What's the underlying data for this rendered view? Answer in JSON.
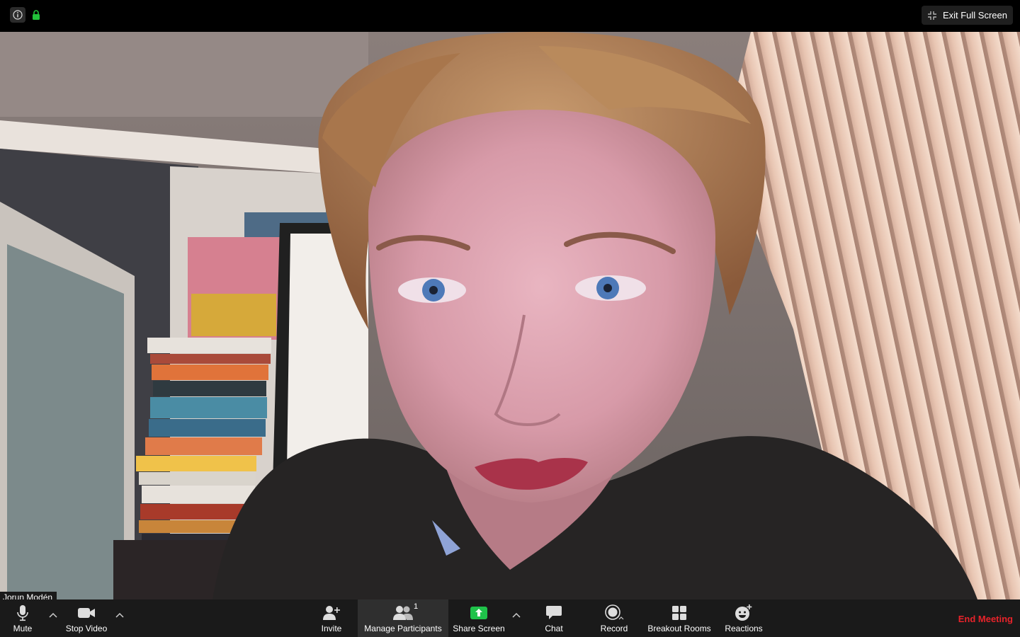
{
  "topbar": {
    "info_icon": "info-icon",
    "lock_icon": "lock-icon",
    "exit_fullscreen_label": "Exit Full Screen"
  },
  "video": {
    "participant_name": "Jorun Modén"
  },
  "toolbar": {
    "mute_label": "Mute",
    "stop_video_label": "Stop Video",
    "invite_label": "Invite",
    "manage_participants_label": "Manage Participants",
    "participants_count": "1",
    "share_screen_label": "Share Screen",
    "chat_label": "Chat",
    "record_label": "Record",
    "breakout_rooms_label": "Breakout Rooms",
    "reactions_label": "Reactions",
    "end_meeting_label": "End Meeting"
  },
  "colors": {
    "toolbar_bg": "#1a1a1a",
    "share_green": "#1fc24a",
    "end_red": "#e8232a",
    "lock_green": "#22c33a"
  }
}
